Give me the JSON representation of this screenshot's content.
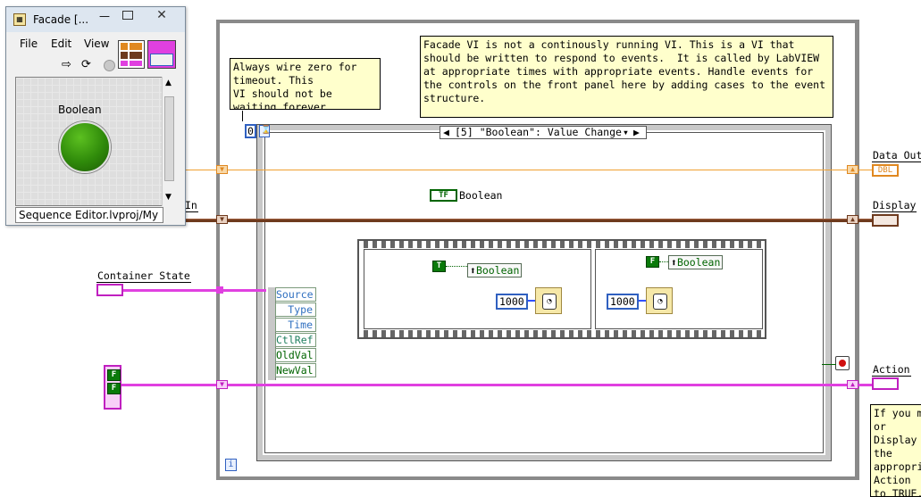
{
  "window": {
    "title": "Facade [...",
    "menu": [
      "File",
      "Edit",
      "View"
    ],
    "front_panel": {
      "boolean_label": "Boolean"
    },
    "status": "Sequence Editor.lvproj/My"
  },
  "comments": {
    "timeout": "Always wire zero for\ntimeout. This\nVI should not be\nwaiting forever.",
    "facade": "Facade VI is not a continously running VI. This is a VI that\nshould be written to respond to events.  It is called by LabVIEW\nat appropriate times with appropriate events. Handle events for\nthe controls on the front panel here by adding cases to the event\nstructure.",
    "right": "If you m\nor\nDisplay\nthe\nappropri\nAction\nto TRUE."
  },
  "timeout_value": "0",
  "event_case": "[5] \"Boolean\": Value Change",
  "labels": {
    "data_out": "Data Out",
    "display": "Display",
    "in_label": "In",
    "container_state": "Container State",
    "action": "Action",
    "boolean_terminal": "Boolean"
  },
  "terminal_text": {
    "dbl": "DBL",
    "tf": "TF",
    "t": "T",
    "f": "F",
    "stop": "●",
    "iteration": "i"
  },
  "event_data": [
    "Source",
    "Type",
    "Time",
    "CtlRef",
    "OldVal",
    "NewVal"
  ],
  "sequence": {
    "frame1": {
      "bool_value": "T",
      "property": "Boolean",
      "wait_ms": "1000"
    },
    "frame2": {
      "bool_value": "F",
      "property": "Boolean",
      "wait_ms": "1000"
    }
  },
  "colors": {
    "orange_wire": "#f0a030",
    "brown_wire": "#6e3a1e",
    "pink_wire": "#e040e0",
    "bool_green": "#0a7a0a",
    "note_yellow": "#ffffcc"
  }
}
